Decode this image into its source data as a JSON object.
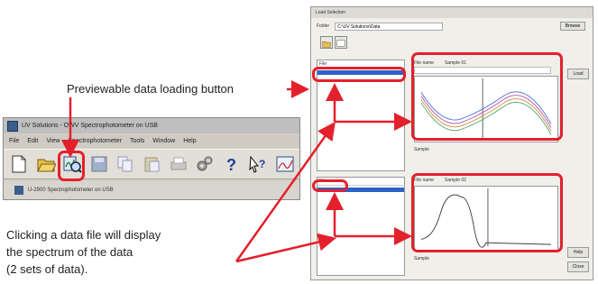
{
  "captions": {
    "loading_button": "Previewable data loading button",
    "click_file_lines": [
      "Clicking a data file will display",
      "the spectrum of the data",
      "(2 sets of data)."
    ]
  },
  "app_window": {
    "title": "UV Solutions - OWV Spectrophotometer on USB",
    "menu": [
      "File",
      "Edit",
      "View",
      "Spectrophotometer",
      "Tools",
      "Window",
      "Help"
    ],
    "toolbar_icons": [
      "new-file-icon",
      "open-folder-icon",
      "previewable-load-icon",
      "save-icon",
      "copy-icon",
      "paste-icon",
      "print-icon",
      "settings-gears-icon",
      "help-question-icon",
      "context-help-icon",
      "spectrum-chart-icon"
    ],
    "status_text": "U-2900 Spectrophotometer on USB"
  },
  "dialog": {
    "title": "Load Selection",
    "path_label": "Folder",
    "path_value": "C:\\UV Solutions\\Data",
    "browse_label": "Browse",
    "panels": [
      {
        "list_header": "File",
        "preview_label": "File name",
        "preview_value": "Sample 01",
        "sample_label": "Sample",
        "sample_value": "",
        "load_label": "Load"
      },
      {
        "list_header": "File",
        "preview_label": "File name",
        "preview_value": "Sample 02",
        "sample_label": "Sample",
        "sample_value": "",
        "load_label": "Load"
      }
    ],
    "close_label": "Close",
    "help_label": "Help"
  },
  "colors": {
    "highlight": "#e4202c",
    "selection": "#2d62c8",
    "window_bg": "#d4d0c8"
  }
}
